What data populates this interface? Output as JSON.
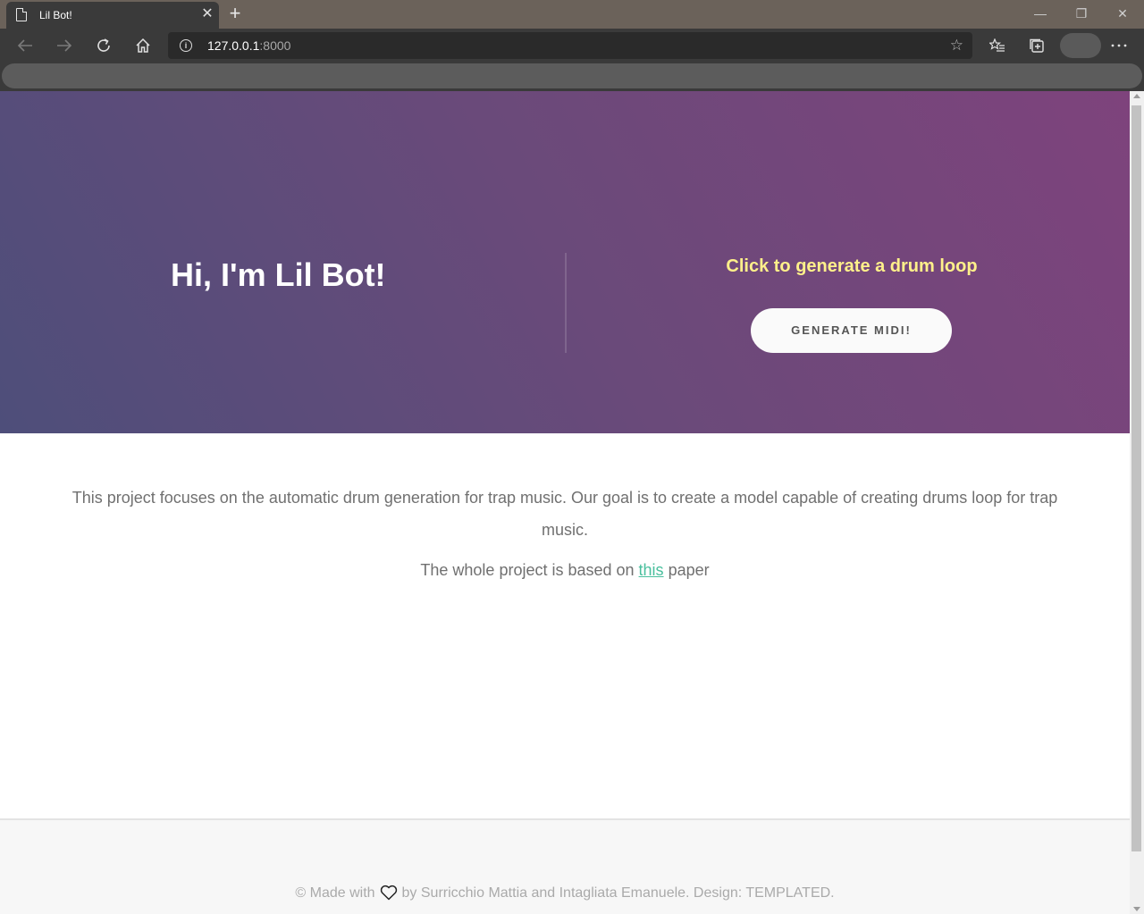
{
  "browser": {
    "tab_title": "Lil Bot!",
    "url_host": "127.0.0.1",
    "url_port": ":8000",
    "icons": {
      "page": "page-icon",
      "close": "close-icon",
      "new_tab": "plus-icon",
      "back": "back-arrow-icon",
      "forward": "forward-arrow-icon",
      "reload": "reload-icon",
      "home": "home-icon",
      "info": "info-icon",
      "favorite": "star-icon",
      "favorites_list": "favorites-icon",
      "collections": "collections-icon",
      "menu": "more-icon"
    }
  },
  "banner": {
    "title": "Hi, I'm Lil Bot!",
    "prompt": "Click to generate a drum loop",
    "button_label": "GENERATE MIDI!",
    "prompt_color": "#fff08a"
  },
  "content": {
    "paragraph1": "This project focuses on the automatic drum generation for trap music. Our goal is to create a model capable of creating drums loop for trap music.",
    "paragraph2_before": "The whole project is based on ",
    "paragraph2_link": "this",
    "paragraph2_after": " paper",
    "link_color": "#49bf9d"
  },
  "footer": {
    "prefix": "© Made with",
    "suffix": "by Surricchio Mattia and Intagliata Emanuele. Design: TEMPLATED.",
    "icon": "heart-icon"
  }
}
